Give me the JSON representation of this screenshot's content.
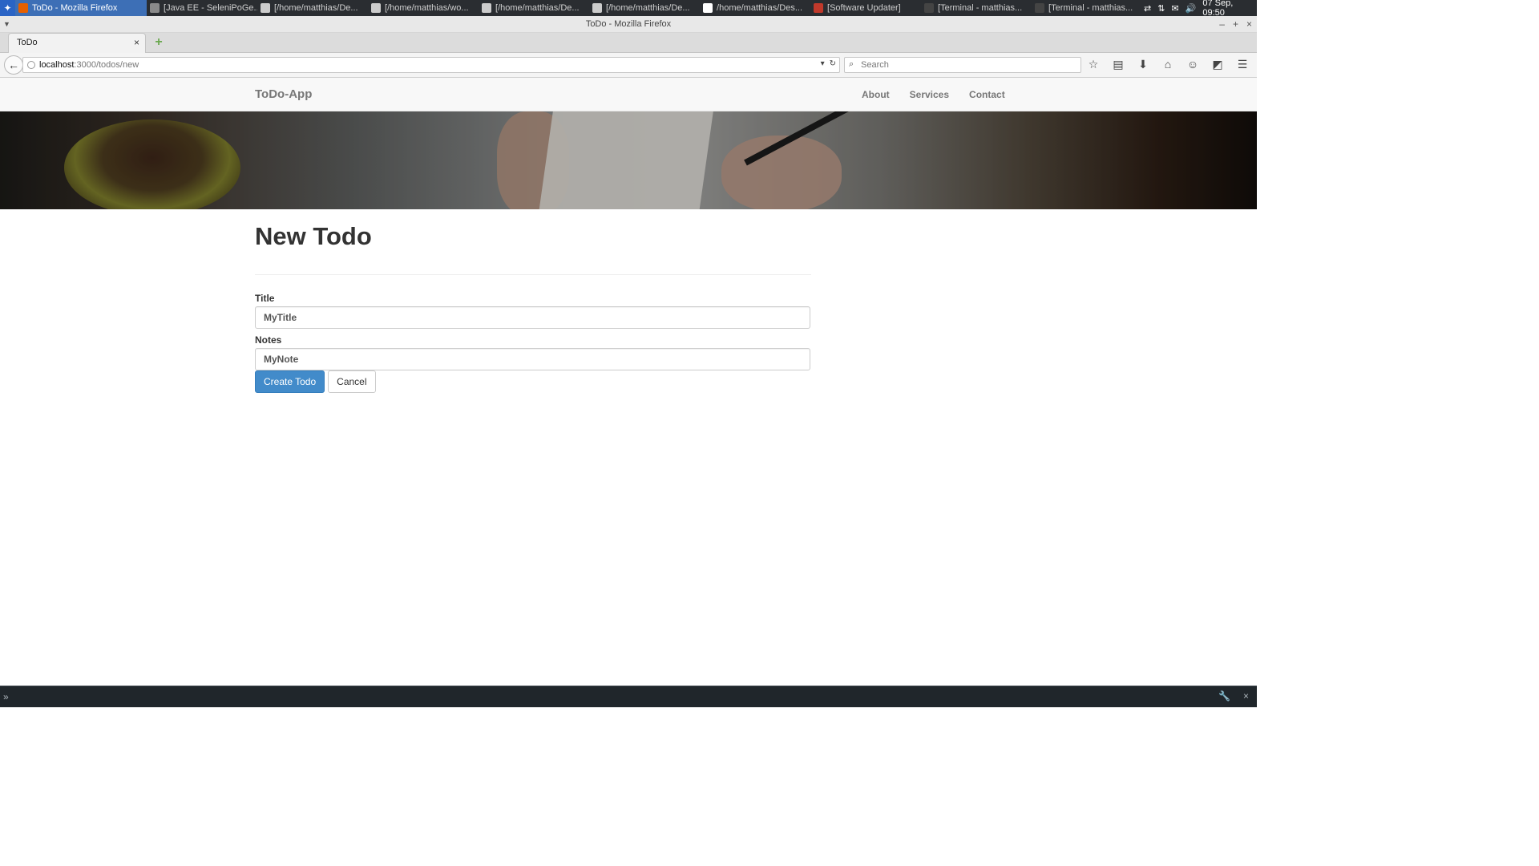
{
  "taskbar": {
    "tasks": [
      {
        "label": "ToDo - Mozilla Firefox",
        "icon": "firefox-icon",
        "color": "#e66000",
        "active": true
      },
      {
        "label": "[Java EE - SeleniPoGe...",
        "icon": "eclipse-icon",
        "color": "#8a8a8a",
        "active": false
      },
      {
        "label": "[/home/matthias/De...",
        "icon": "editor-icon",
        "color": "#cccccc",
        "active": false
      },
      {
        "label": "[/home/matthias/wo...",
        "icon": "editor-icon",
        "color": "#cccccc",
        "active": false
      },
      {
        "label": "[/home/matthias/De...",
        "icon": "editor-icon",
        "color": "#cccccc",
        "active": false
      },
      {
        "label": "[/home/matthias/De...",
        "icon": "editor-icon",
        "color": "#cccccc",
        "active": false
      },
      {
        "label": "/home/matthias/Des...",
        "icon": "editor-icon",
        "color": "#ffffff",
        "active": false
      },
      {
        "label": "[Software Updater]",
        "icon": "updater-icon",
        "color": "#c0392b",
        "active": false
      },
      {
        "label": "[Terminal - matthias...",
        "icon": "terminal-icon",
        "color": "#444444",
        "active": false
      },
      {
        "label": "[Terminal - matthias...",
        "icon": "terminal-icon",
        "color": "#444444",
        "active": false
      }
    ],
    "clock": "07 Sep, 09:50"
  },
  "window": {
    "title": "ToDo - Mozilla Firefox"
  },
  "browser": {
    "tab_title": "ToDo",
    "url_host": "localhost",
    "url_path": ":3000/todos/new",
    "search_placeholder": "Search"
  },
  "site": {
    "brand": "ToDo-App",
    "nav": [
      "About",
      "Services",
      "Contact"
    ]
  },
  "form": {
    "heading": "New Todo",
    "title_label": "Title",
    "title_value": "MyTitle",
    "notes_label": "Notes",
    "notes_value": "MyNote",
    "submit_label": "Create Todo",
    "cancel_label": "Cancel"
  },
  "colors": {
    "primary": "#428bca",
    "taskbar_active": "#3d6fb6"
  }
}
